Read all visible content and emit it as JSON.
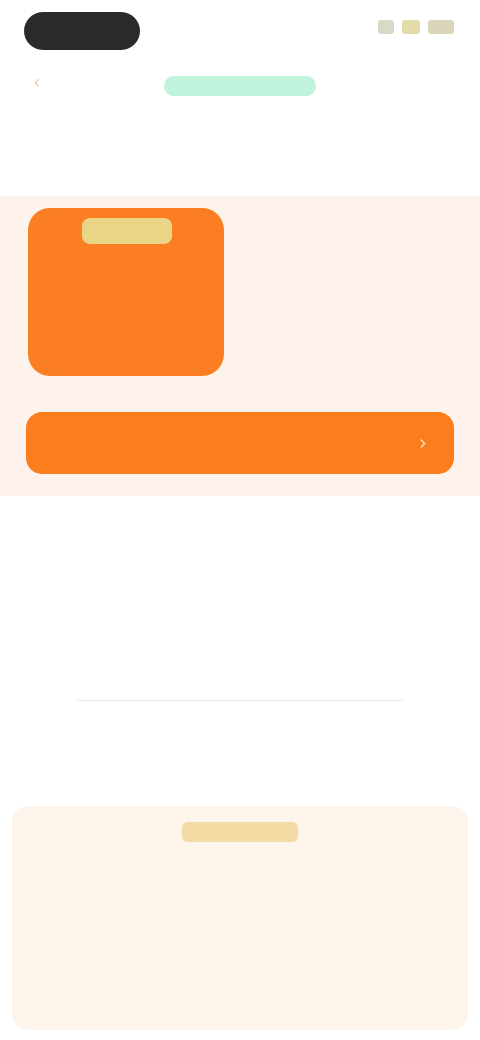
{
  "status_bar": {
    "pill_label": ""
  },
  "header": {
    "back_icon": "chevron-left-icon",
    "brand_label": "",
    "title": ""
  },
  "hero": {
    "badge": "",
    "tile_text": "",
    "value": "",
    "value_caption": ""
  },
  "cta": {
    "label": "",
    "arrow_icon": "chevron-right-icon",
    "note": ""
  },
  "details": {
    "row1_label": "",
    "row1_value_line1": "",
    "row1_value_line2": "",
    "row2_label": "",
    "row2_value": ""
  },
  "info_line": "",
  "notice": {
    "tag": "",
    "body": "",
    "footer": ""
  },
  "colors": {
    "accent": "#fb7d1e",
    "panel": "#fdf3ec",
    "brand": "#bff3dc"
  }
}
